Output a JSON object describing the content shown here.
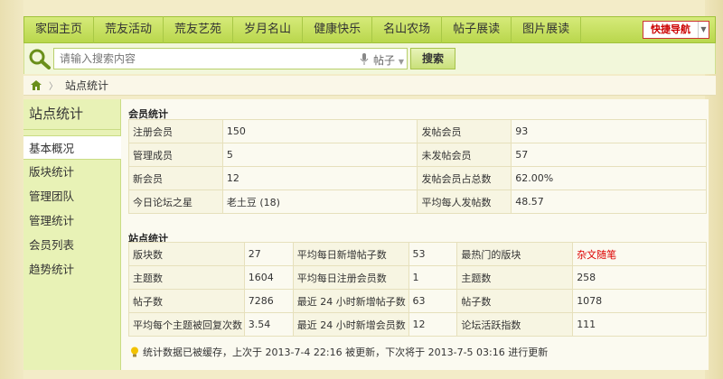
{
  "nav": {
    "items": [
      "家园主页",
      "荒友活动",
      "荒友艺苑",
      "岁月名山",
      "健康快乐",
      "名山农场",
      "帖子展读",
      "图片展读"
    ],
    "quick_nav": "快捷导航"
  },
  "search": {
    "placeholder": "请输入搜索内容",
    "type": "帖子",
    "button": "搜索"
  },
  "breadcrumb": {
    "current": "站点统计"
  },
  "sidebar": {
    "title": "站点统计",
    "items": [
      "基本概况",
      "版块统计",
      "管理团队",
      "管理统计",
      "会员列表",
      "趋势统计"
    ]
  },
  "members": {
    "title": "会员统计",
    "rows": [
      [
        "注册会员",
        "150",
        "发帖会员",
        "93"
      ],
      [
        "管理成员",
        "5",
        "未发帖会员",
        "57"
      ],
      [
        "新会员",
        "12",
        "发帖会员占总数",
        "62.00%"
      ],
      [
        "今日论坛之星",
        "老土豆 (18)",
        "平均每人发帖数",
        "48.57"
      ]
    ]
  },
  "site": {
    "title": "站点统计",
    "rows": [
      [
        "版块数",
        "27",
        "平均每日新增帖子数",
        "53",
        "最热门的版块",
        "杂文随笔"
      ],
      [
        "主题数",
        "1604",
        "平均每日注册会员数",
        "1",
        "主题数",
        "258"
      ],
      [
        "帖子数",
        "7286",
        "最近 24 小时新增帖子数",
        "63",
        "帖子数",
        "1078"
      ],
      [
        "平均每个主题被回复次数",
        "3.54",
        "最近 24 小时新增会员数",
        "12",
        "论坛活跃指数",
        "111"
      ]
    ]
  },
  "cache_note": "统计数据已被缓存，上次于 2013-7-4 22:16 被更新，下次将于 2013-7-5 03:16 进行更新"
}
